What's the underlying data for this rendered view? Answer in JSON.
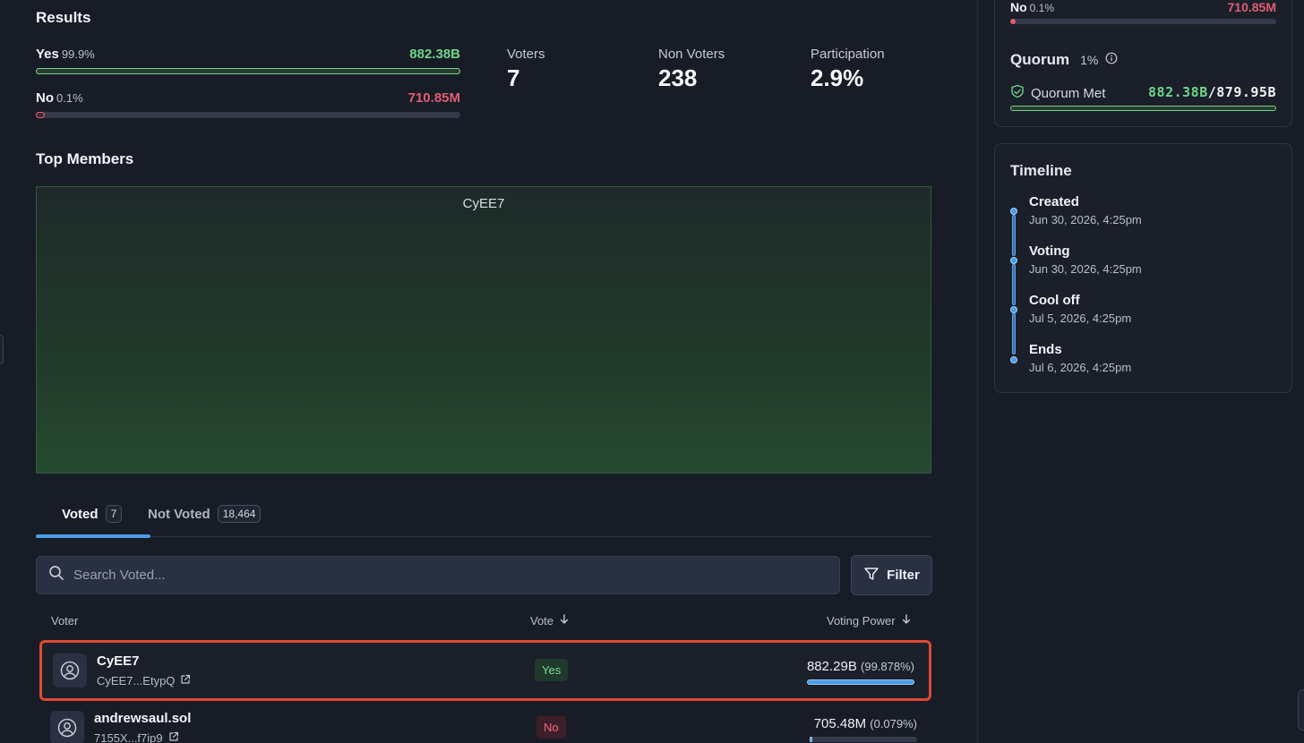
{
  "results": {
    "title": "Results",
    "yes": {
      "label": "Yes",
      "percent": "99.9%",
      "value": "882.38B",
      "fraction": 0.999
    },
    "no": {
      "label": "No",
      "percent": "0.1%",
      "value": "710.85M",
      "fraction": 0.001
    }
  },
  "stats": {
    "voters": {
      "label": "Voters",
      "value": "7"
    },
    "non_voters": {
      "label": "Non Voters",
      "value": "238"
    },
    "participation": {
      "label": "Participation",
      "value": "2.9%"
    }
  },
  "top_members": {
    "title": "Top Members",
    "treemap_label": "CyEE7"
  },
  "tabs": [
    {
      "label": "Voted",
      "count": "7",
      "active": true
    },
    {
      "label": "Not Voted",
      "count": "18,464",
      "active": false
    }
  ],
  "search": {
    "placeholder": "Search Voted..."
  },
  "filter": {
    "label": "Filter"
  },
  "table": {
    "headers": {
      "voter": "Voter",
      "vote": "Vote",
      "power": "Voting Power"
    },
    "rows": [
      {
        "name": "CyEE7",
        "address": "CyEE7...EtypQ",
        "vote": "Yes",
        "power": "882.29B",
        "power_pct": "(99.878%)",
        "power_fraction": 0.99878
      },
      {
        "name": "andrewsaul.sol",
        "address": "7155X...f7ip9",
        "vote": "No",
        "power": "705.48M",
        "power_pct": "(0.079%)",
        "power_fraction": 0.00079
      }
    ]
  },
  "side": {
    "no": {
      "label": "No",
      "percent": "0.1%",
      "value": "710.85M",
      "fraction": 0.001
    },
    "quorum": {
      "title": "Quorum",
      "percent": "1%",
      "status": "Quorum Met",
      "current": "882.38B",
      "separator": "/",
      "required": "879.95B",
      "fraction": 1.0
    },
    "timeline": {
      "title": "Timeline",
      "items": [
        {
          "label": "Created",
          "date": "Jun 30, 2026, 4:25pm"
        },
        {
          "label": "Voting",
          "date": "Jun 30, 2026, 4:25pm"
        },
        {
          "label": "Cool off",
          "date": "Jul 5, 2026, 4:25pm"
        },
        {
          "label": "Ends",
          "date": "Jul 6, 2026, 4:25pm"
        }
      ]
    }
  },
  "colors": {
    "yes": "#6fd58a",
    "no": "#e05d72",
    "accent": "#4a9ce8",
    "highlight": "#dd4a30"
  }
}
